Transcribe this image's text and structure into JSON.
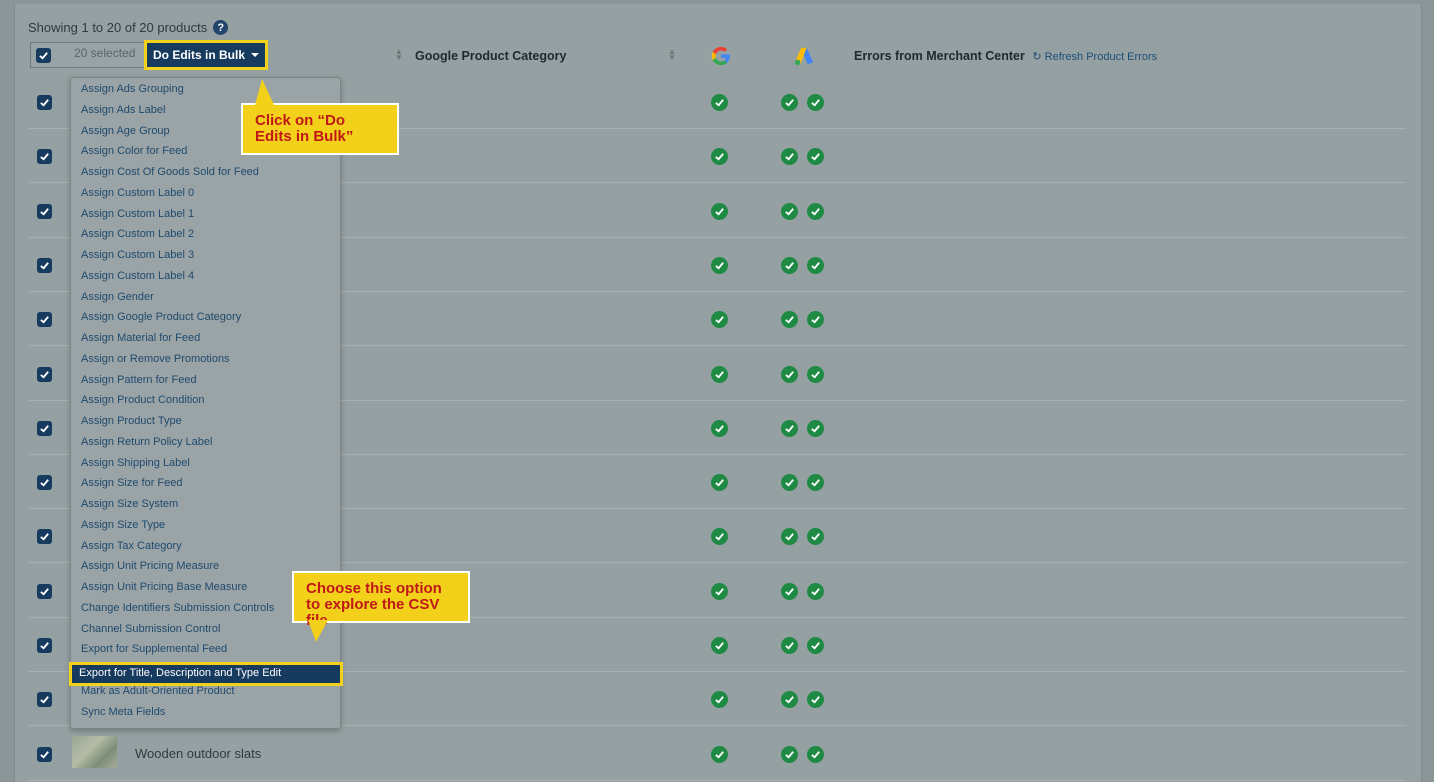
{
  "showing_text": "Showing 1 to 20 of 20 products",
  "help_glyph": "?",
  "toolbar": {
    "selected_label": "20 selected",
    "bulk_button_label": "Do Edits in Bulk"
  },
  "columns": {
    "category": "Google Product Category",
    "errors": "Errors from Merchant Center",
    "refresh": "Refresh Product Errors"
  },
  "menu": {
    "items": [
      "Assign Ads Grouping",
      "Assign Ads Label",
      "Assign Age Group",
      "Assign Color for Feed",
      "Assign Cost Of Goods Sold for Feed",
      "Assign Custom Label 0",
      "Assign Custom Label 1",
      "Assign Custom Label 2",
      "Assign Custom Label 3",
      "Assign Custom Label 4",
      "Assign Gender",
      "Assign Google Product Category",
      "Assign Material for Feed",
      "Assign or Remove Promotions",
      "Assign Pattern for Feed",
      "Assign Product Condition",
      "Assign Product Type",
      "Assign Return Policy Label",
      "Assign Shipping Label",
      "Assign Size for Feed",
      "Assign Size System",
      "Assign Size Type",
      "Assign Tax Category",
      "Assign Unit Pricing Measure",
      "Assign Unit Pricing Base Measure",
      "Change Identifiers Submission Controls",
      "Channel Submission Control",
      "Export for Supplemental Feed",
      "Export for Title, Description and Type Edit",
      "Mark as Adult-Oriented Product",
      "Sync Meta Fields"
    ],
    "active_index": 28
  },
  "callouts": {
    "bulk_prefix": "Click on ",
    "bulk_emph": "“Do Edits in Bulk”",
    "export_text": "Choose this option to explore the CSV file"
  },
  "last_row_product": "Wooden outdoor slats",
  "colors": {
    "accent": "#173b5f",
    "highlight": "#f3d11b",
    "callout_text": "#c01818",
    "status_ok": "#1f8a44"
  }
}
